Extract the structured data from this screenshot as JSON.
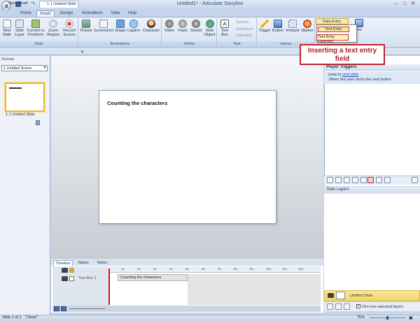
{
  "window": {
    "title": "Untitled1* - Articulate Storyline",
    "app_orb": "a"
  },
  "ribbon_tabs": [
    "Home",
    "Insert",
    "Design",
    "Animations",
    "View",
    "Help"
  ],
  "ribbon_groups": {
    "slide": {
      "label": "Slide",
      "buttons": [
        "New Slide",
        "Slide Layer",
        "Convert to Freeform",
        "Zoom Region",
        "Record Screen"
      ]
    },
    "illustrations": {
      "label": "Illustrations",
      "buttons": [
        "Picture",
        "Screenshot",
        "Shape",
        "Caption",
        "Character"
      ]
    },
    "media": {
      "label": "Media",
      "buttons": [
        "Video",
        "Flash",
        "Sound",
        "Web Object"
      ]
    },
    "text": {
      "label": "Text",
      "buttons": [
        "Text Box"
      ],
      "small_buttons": [
        "Symbol",
        "Reference",
        "Hyperlink"
      ]
    },
    "interactivity": {
      "label": "Interac",
      "buttons": [
        "Trigger",
        "Button",
        "Hotspot",
        "Marker"
      ]
    },
    "data_entry": {
      "label": "Data Entry",
      "view_partial": "iew"
    }
  },
  "data_entry_menu": {
    "item1": "Text Entry",
    "item2": "Text Entry Field",
    "item2_overflow": "ntry"
  },
  "callout": {
    "text": "Inserting a text entry field"
  },
  "doc_tabs": [
    "Story View",
    "1.1 Untitled Slide"
  ],
  "scenes": {
    "label": "Scenes",
    "selected": "1 Untitled Scene",
    "slide_label": "1.1 Untitled Slide"
  },
  "slide": {
    "title": "Counting the characters"
  },
  "timeline": {
    "tabs": [
      "Timeline",
      "States",
      "Notes"
    ],
    "row_label": "Text Box 1",
    "row_bar": "Counting the characters",
    "ticks": [
      "1s",
      "2s",
      "3s",
      "4s",
      "5s",
      "6s",
      "7s",
      "8s",
      "9s",
      "10s",
      "11s",
      "12s"
    ]
  },
  "triggers": {
    "header": "Player Triggers",
    "jump_prefix": "Jump to ",
    "jump_link": "next slide",
    "condition": "When the user clicks the next button"
  },
  "layers": {
    "header": "Slide Layers",
    "base": "Untitled Slide",
    "dim_label": "Dim non-selected layers",
    "dim_checked": true
  },
  "status": {
    "slide_count": "Slide 1 of 1",
    "theme": "\"Clean\"",
    "zoom": "75%"
  }
}
